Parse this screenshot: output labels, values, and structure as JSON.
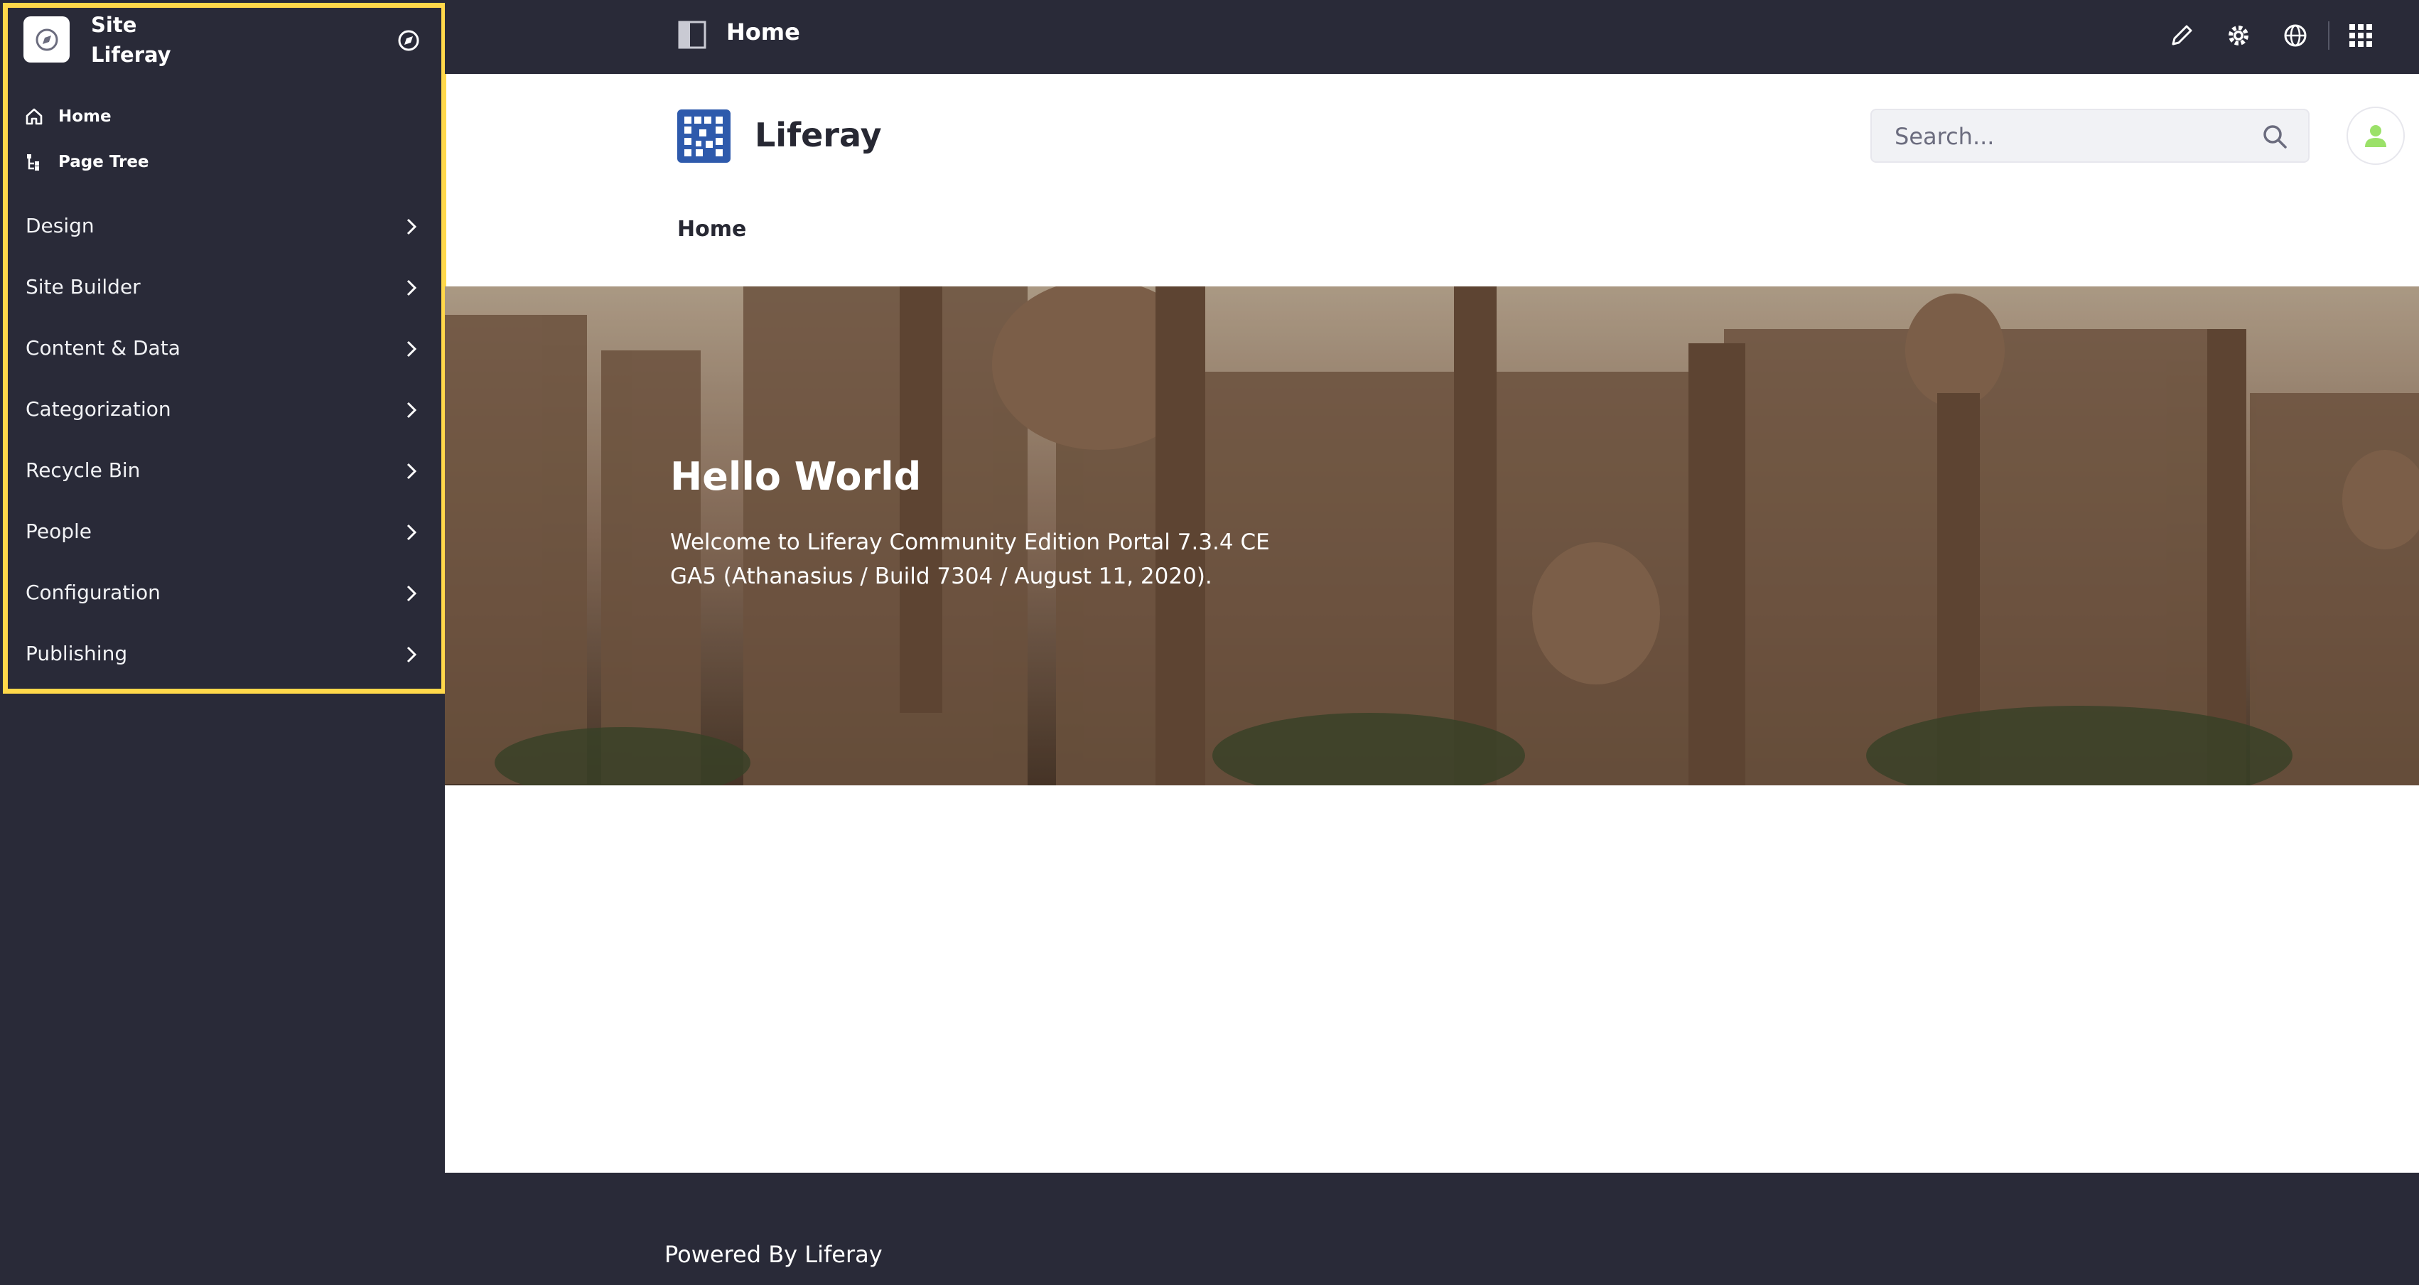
{
  "sidebar": {
    "site_label": "Site",
    "site_name": "Liferay",
    "top_links": [
      {
        "label": "Home",
        "icon": "home-icon"
      },
      {
        "label": "Page Tree",
        "icon": "page-tree-icon"
      }
    ],
    "items": [
      {
        "label": "Design"
      },
      {
        "label": "Site Builder"
      },
      {
        "label": "Content & Data"
      },
      {
        "label": "Categorization"
      },
      {
        "label": "Recycle Bin"
      },
      {
        "label": "People"
      },
      {
        "label": "Configuration"
      },
      {
        "label": "Publishing"
      }
    ]
  },
  "topbar": {
    "title": "Home",
    "icons": [
      "pencil-icon",
      "gear-icon",
      "simulation-icon",
      "apps-grid-icon"
    ]
  },
  "header": {
    "site_name": "Liferay",
    "search_placeholder": "Search...",
    "nav_home": "Home"
  },
  "banner": {
    "title": "Hello World",
    "text": "Welcome to Liferay Community Edition Portal 7.3.4 CE GA5 (Athanasius / Build 7304 / August 11, 2020)."
  },
  "footer": {
    "text": "Powered By Liferay"
  },
  "colors": {
    "sidebar_bg": "#292a38",
    "highlight": "#ffd84a",
    "logo_blue": "#2e5aac",
    "avatar_green": "#9be169"
  }
}
